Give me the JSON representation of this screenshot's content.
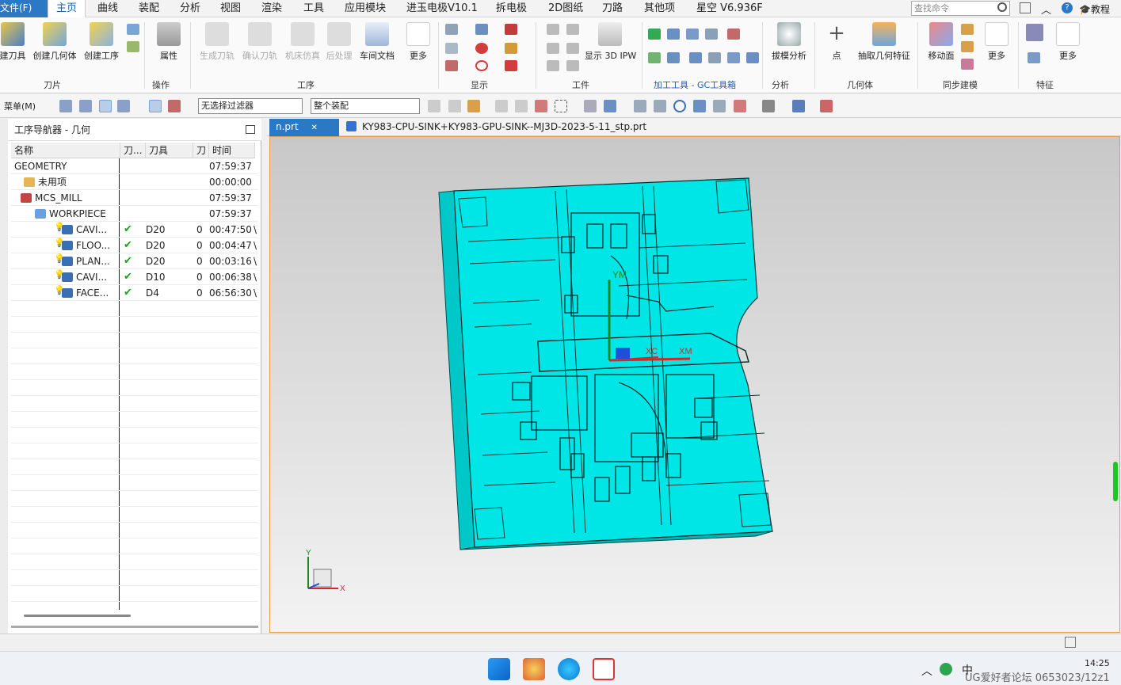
{
  "menubar": {
    "file": "文件(F)",
    "items": [
      "主页",
      "曲线",
      "装配",
      "分析",
      "视图",
      "渲染",
      "工具",
      "应用模块",
      "进玉电极V10.1",
      "拆电极",
      "2D图纸",
      "刀路",
      "其他项",
      "星空 V6.936F"
    ],
    "search_placeholder": "查找命令",
    "tutorial": "教程"
  },
  "ribbon": {
    "buttons": {
      "create_tool": "建刀具",
      "create_geometry": "创建几何体",
      "create_operation": "创建工序",
      "properties": "属性",
      "generate_path": "生成刀轨",
      "confirm_path": "确认刀轨",
      "machine_sim": "机床仿真",
      "post_process": "后处理",
      "shop_doc": "车间文档",
      "more1": "更多",
      "show_3d_ipw": "显示 3D IPW",
      "draft_analysis": "拔模分析",
      "point": "点",
      "extract_feature": "抽取几何特征",
      "move_face": "移动面",
      "more2": "更多",
      "more3": "更多"
    },
    "groups": {
      "tool": "刀片",
      "ops": "操作",
      "process": "工序",
      "display": "显示",
      "workpiece": "工件",
      "gc": "加工工具 - GC工具箱",
      "analysis": "分析",
      "geometry": "几何体",
      "sync": "同步建模",
      "feature": "特征"
    }
  },
  "toolbar2": {
    "menu": "菜单(M)",
    "filter": "无选择过滤器",
    "assembly": "整个装配"
  },
  "navigator": {
    "title": "工序导航器 - 几何",
    "columns": [
      "名称",
      "刀...",
      "刀具",
      "刀",
      "时间"
    ],
    "rows": [
      {
        "name": "GEOMETRY",
        "check": "",
        "tool": "",
        "num": "",
        "time": "07:59:37",
        "v": ""
      },
      {
        "name": "未用项",
        "check": "",
        "tool": "",
        "num": "",
        "time": "00:00:00",
        "v": ""
      },
      {
        "name": "MCS_MILL",
        "check": "",
        "tool": "",
        "num": "",
        "time": "07:59:37",
        "v": ""
      },
      {
        "name": "WORKPIECE",
        "check": "",
        "tool": "",
        "num": "",
        "time": "07:59:37",
        "v": ""
      },
      {
        "name": "CAVI...",
        "check": "✔",
        "tool": "D20",
        "num": "0",
        "time": "00:47:50",
        "v": "\\"
      },
      {
        "name": "FLOO...",
        "check": "✔",
        "tool": "D20",
        "num": "0",
        "time": "00:04:47",
        "v": "\\"
      },
      {
        "name": "PLAN...",
        "check": "✔",
        "tool": "D20",
        "num": "0",
        "time": "00:03:16",
        "v": "\\"
      },
      {
        "name": "CAVI...",
        "check": "✔",
        "tool": "D10",
        "num": "0",
        "time": "00:06:38",
        "v": "\\"
      },
      {
        "name": "FACE...",
        "check": "✔",
        "tool": "D4",
        "num": "0",
        "time": "06:56:30",
        "v": "\\"
      }
    ]
  },
  "tabs": {
    "active": "n.prt",
    "second": "KY983-CPU-SINK+KY983-GPU-SINK--MJ3D-2023-5-11_stp.prt"
  },
  "viewport": {
    "model_color": "#00e5e5",
    "labels": {
      "ym": "YM",
      "xm": "XM",
      "xc": "XC",
      "y": "Y",
      "x": "X"
    }
  },
  "taskbar": {
    "time": "14:25",
    "watermark": "UG爱好者论坛 0653023/12z1",
    "ime": "中"
  }
}
